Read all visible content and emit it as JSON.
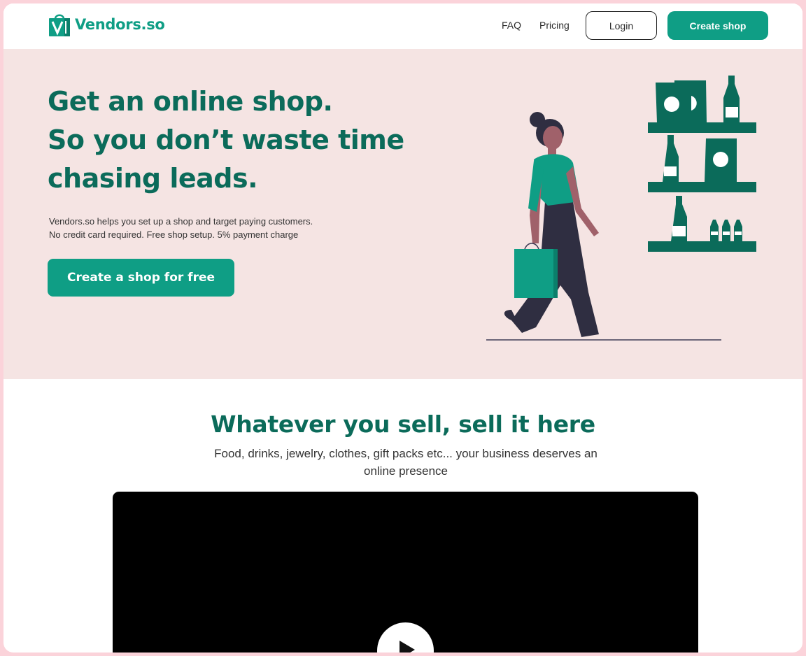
{
  "header": {
    "logo_text": "Vendors.so",
    "nav": {
      "faq": "FAQ",
      "pricing": "Pricing"
    },
    "login_label": "Login",
    "create_shop_label": "Create shop"
  },
  "hero": {
    "title_lines": [
      "Get an online shop.",
      "So you don’t waste time",
      "chasing leads."
    ],
    "description_lines": [
      "Vendors.so helps you set up a shop and target paying customers.",
      "No credit card required. Free shop setup. 5% payment charge"
    ],
    "cta_label": "Create a shop for free"
  },
  "section": {
    "title": "Whatever you sell, sell it here",
    "subtitle": "Food, drinks, jewelry, clothes, gift packs etc... your business deserves an online presence"
  },
  "colors": {
    "brand": "#0f9e85",
    "brand_dark": "#0b6b5a",
    "hero_bg": "#f5e4e3",
    "page_border": "#fbd3da"
  },
  "icons": {
    "logo": "shopping-bag-icon",
    "play": "play-icon"
  }
}
